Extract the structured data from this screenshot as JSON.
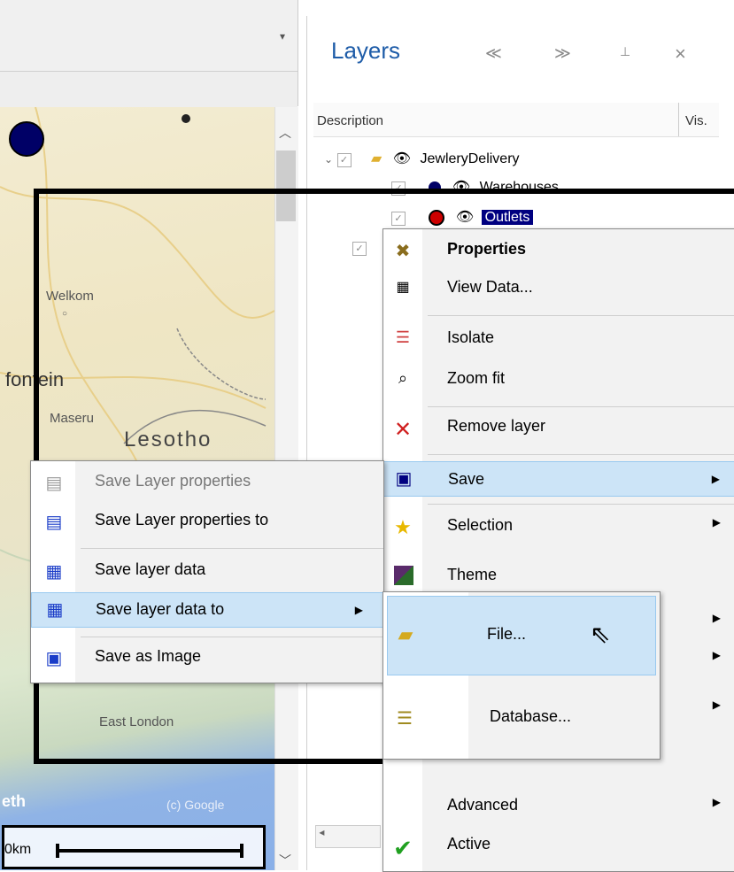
{
  "map": {
    "labels": [
      "Welkom",
      "fontein",
      "Maseru",
      "Lesotho",
      "East London",
      "eth",
      "(c) Google"
    ],
    "scale_text": "0km"
  },
  "layers_panel": {
    "title": "Layers",
    "btn_back": "≪",
    "btn_forward": "≫",
    "btn_pin": "⊥",
    "btn_close": "×",
    "col_description": "Description",
    "col_visible": "Vis.",
    "tree": [
      {
        "label": "JewleryDelivery"
      },
      {
        "label": "Warehouses"
      },
      {
        "label": "Outlets"
      }
    ]
  },
  "context_menu": {
    "items": [
      {
        "label": "Properties",
        "icon": "tools-icon"
      },
      {
        "label": "View Data...",
        "icon": "table-icon"
      },
      {
        "label": "Isolate",
        "icon": "isolate-icon"
      },
      {
        "label": "Zoom fit",
        "icon": "zoom-fit-icon"
      },
      {
        "label": "Remove layer",
        "icon": "remove-icon"
      },
      {
        "label": "Save",
        "icon": "save-icon"
      },
      {
        "label": "Selection",
        "icon": "star-icon"
      },
      {
        "label": "Theme",
        "icon": "theme-icon"
      },
      {
        "label": "Advanced",
        "icon": ""
      },
      {
        "label": "Active",
        "icon": "check-icon"
      }
    ]
  },
  "save_submenu": {
    "items": [
      {
        "label": "Save Layer properties",
        "disabled": true
      },
      {
        "label": "Save Layer properties to"
      },
      {
        "label": "Save layer data"
      },
      {
        "label": "Save layer data to"
      },
      {
        "label": "Save as Image"
      }
    ]
  },
  "save_to_submenu": {
    "items": [
      {
        "label": "File..."
      },
      {
        "label": "Database..."
      }
    ]
  },
  "colors": {
    "accent": "#1e5ca8",
    "highlight": "#cce4f7",
    "selection": "#000080"
  }
}
